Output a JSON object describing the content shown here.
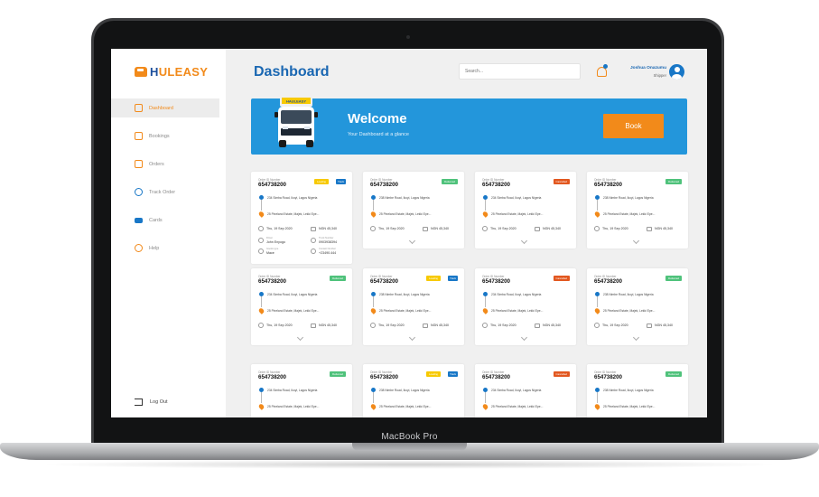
{
  "device": {
    "label": "MacBook Pro"
  },
  "brand": {
    "logo_part1": "H",
    "logo_part2": "ULEASY",
    "accent": "#f28a1a",
    "primary": "#1877c7"
  },
  "sidebar": {
    "items": [
      {
        "label": "Dashboard",
        "icon": "grid-icon"
      },
      {
        "label": "Bookings",
        "icon": "bookmark-icon"
      },
      {
        "label": "Orders",
        "icon": "truck-icon"
      },
      {
        "label": "Track Order",
        "icon": "location-icon"
      },
      {
        "label": "Cards",
        "icon": "card-icon"
      },
      {
        "label": "Help",
        "icon": "help-icon"
      }
    ],
    "logout": "Log Out"
  },
  "header": {
    "title": "Dashboard",
    "search_placeholder": "Search...",
    "user_name": "Joshua Onazumu",
    "user_role": "Shipper"
  },
  "banner": {
    "van_label": "HAULEASY",
    "title": "Welcome",
    "subtitle": "Your Dashboard at a glance",
    "book_label": "Book"
  },
  "cards": [
    {
      "id_label": "Order ID Number",
      "id": "654738200",
      "status": "Loading",
      "status_color": "#f7c900",
      "track": "Track",
      "from": "234 Simba Road, Ikoyi, Lagos Nigeria",
      "to": "25 Pineland Estate, Majek, Lekki Epe...",
      "date": "Thu, 19 Sep 2020",
      "price": "NGN 45,340",
      "expanded": true,
      "extra": [
        {
          "label": "Driver",
          "value": "John Enyogo"
        },
        {
          "label": "Truck Number",
          "value": "0903938394"
        },
        {
          "label": "Goods type",
          "value": "Mace"
        },
        {
          "label": "Contact Number",
          "value": "+23490.444"
        }
      ]
    },
    {
      "id_label": "Order ID Number",
      "id": "654738200",
      "status": "Delivered",
      "status_color": "#4fc27b",
      "from": "238 Nimbe Road, Ikoyi, Lagos Nigeria",
      "to": "25 Pineland Estate, Majek, Lekki Epe...",
      "date": "Thu, 19 Sep 2020",
      "price": "NGN 45,340"
    },
    {
      "id_label": "Order ID Number",
      "id": "654738200",
      "status": "Cancelled",
      "status_color": "#e2571f",
      "from": "234 Simba Road, Ikoyi, Lagos Nigeria",
      "to": "25 Pineland Estate, Majek, Lekki Epe...",
      "date": "Thu, 19 Sep 2020",
      "price": "NGN 45,340"
    },
    {
      "id_label": "Order ID Number",
      "id": "654738200",
      "status": "Delivered",
      "status_color": "#4fc27b",
      "from": "238 Nimbe Road, Ikoyi, Lagos Nigeria",
      "to": "25 Pineland Estate, Majek, Lekki Epe...",
      "date": "Thu, 19 Sep 2020",
      "price": "NGN 45,340"
    },
    {
      "id_label": "Order ID Number",
      "id": "654738200",
      "status": "Delivered",
      "status_color": "#4fc27b",
      "from": "234 Simba Road, Ikoyi, Lagos Nigeria",
      "to": "25 Pineland Estate, Majek, Lekki Epe...",
      "date": "Thu, 19 Sep 2020",
      "price": "NGN 45,340"
    },
    {
      "id_label": "Order ID Number",
      "id": "654738200",
      "status": "Loading",
      "status_color": "#f7c900",
      "track": "Track",
      "from": "238 Nimbe Road, Ikoyi, Lagos Nigeria",
      "to": "25 Pineland Estate, Majek, Lekki Epe...",
      "date": "Thu, 19 Sep 2020",
      "price": "NGN 45,340"
    },
    {
      "id_label": "Order ID Number",
      "id": "654738200",
      "status": "Cancelled",
      "status_color": "#e2571f",
      "from": "234 Simba Road, Ikoyi, Lagos Nigeria",
      "to": "25 Pineland Estate, Majek, Lekki Epe...",
      "date": "Thu, 19 Sep 2020",
      "price": "NGN 45,340"
    },
    {
      "id_label": "Order ID Number",
      "id": "654738200",
      "status": "Delivered",
      "status_color": "#4fc27b",
      "from": "238 Nimbe Road, Ikoyi, Lagos Nigeria",
      "to": "25 Pineland Estate, Majek, Lekki Epe...",
      "date": "Thu, 19 Sep 2020",
      "price": "NGN 45,340"
    },
    {
      "id_label": "Order ID Number",
      "id": "654738200",
      "status": "Delivered",
      "status_color": "#4fc27b",
      "from": "234 Simba Road, Ikoyi, Lagos Nigeria",
      "to": "25 Pineland Estate, Majek, Lekki Epe...",
      "date": "",
      "price": ""
    },
    {
      "id_label": "Order ID Number",
      "id": "654738200",
      "status": "Loading",
      "status_color": "#f7c900",
      "track": "Track",
      "from": "238 Nimbe Road, Ikoyi, Lagos Nigeria",
      "to": "25 Pineland Estate, Majek, Lekki Epe...",
      "date": "",
      "price": ""
    },
    {
      "id_label": "Order ID Number",
      "id": "654738200",
      "status": "Cancelled",
      "status_color": "#e2571f",
      "from": "234 Simba Road, Ikoyi, Lagos Nigeria",
      "to": "25 Pineland Estate, Majek, Lekki Epe...",
      "date": "",
      "price": ""
    },
    {
      "id_label": "Order ID Number",
      "id": "654738200",
      "status": "Delivered",
      "status_color": "#4fc27b",
      "from": "238 Nimbe Road, Ikoyi, Lagos Nigeria",
      "to": "25 Pineland Estate, Majek, Lekki Epe...",
      "date": "",
      "price": ""
    }
  ]
}
